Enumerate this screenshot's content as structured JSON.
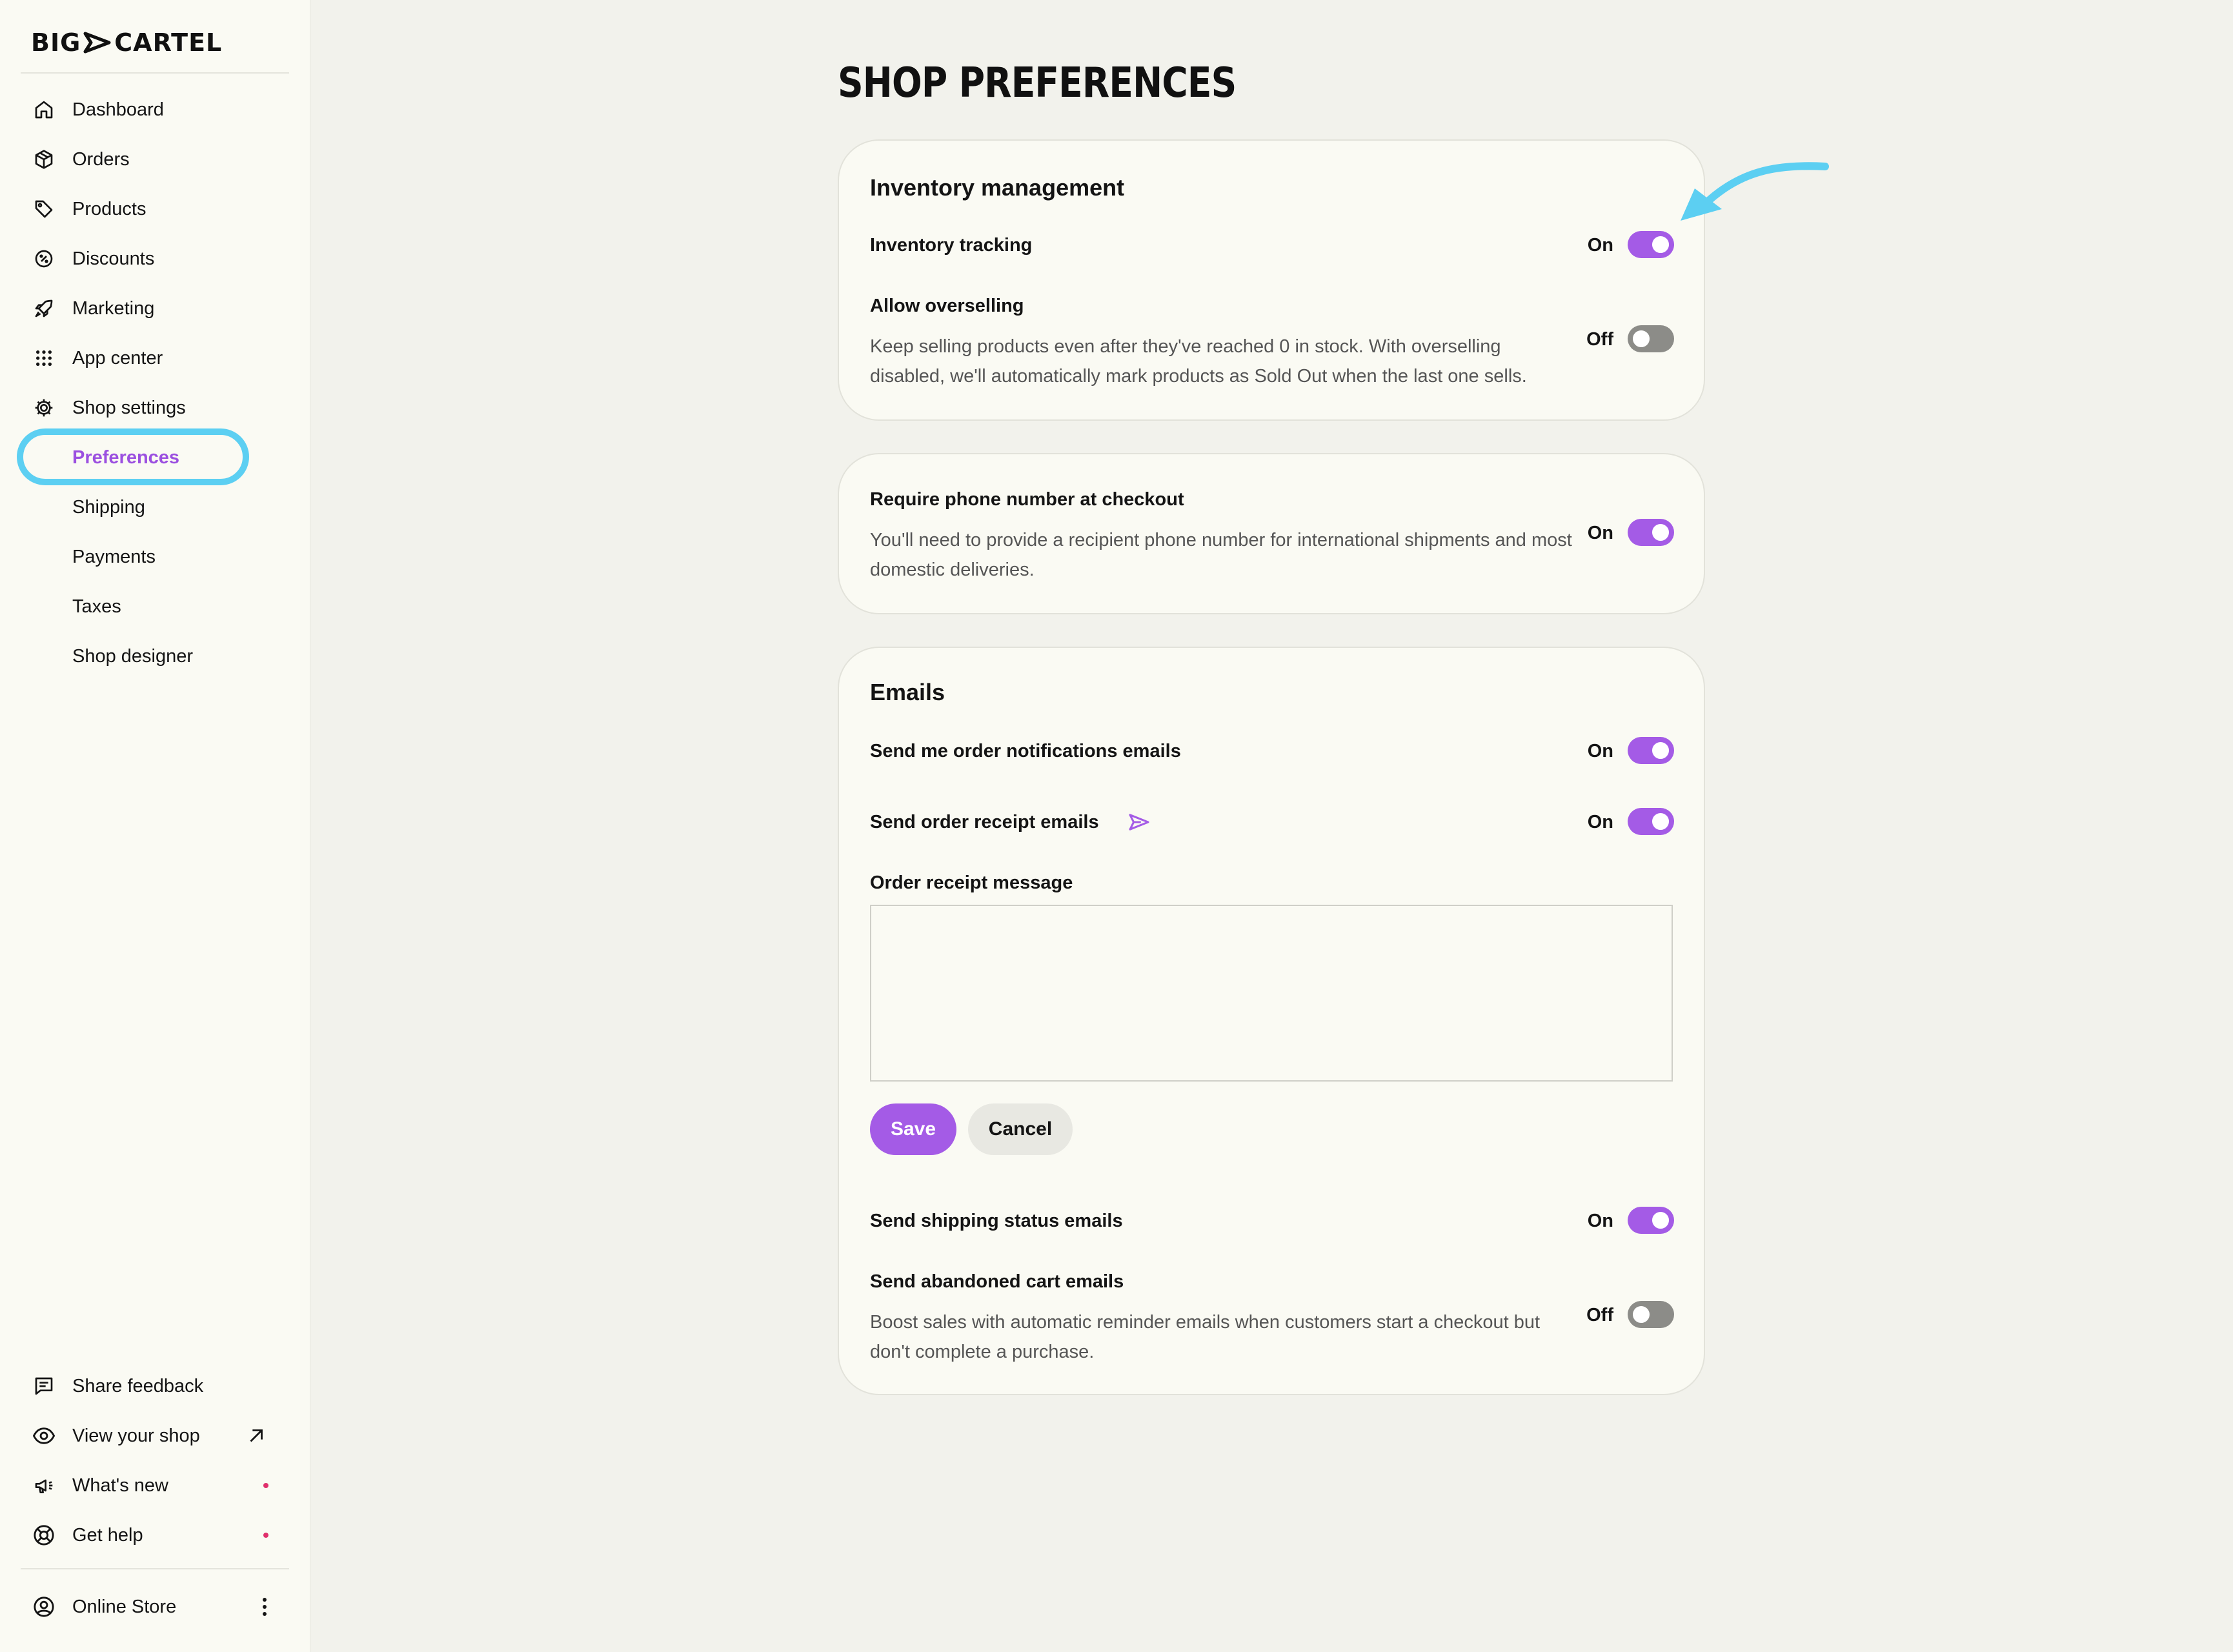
{
  "brand": {
    "name_left": "BIG",
    "name_right": "CARTEL"
  },
  "sidebar": {
    "nav": [
      {
        "label": "Dashboard",
        "icon": "home-icon"
      },
      {
        "label": "Orders",
        "icon": "box-icon"
      },
      {
        "label": "Products",
        "icon": "tag-icon"
      },
      {
        "label": "Discounts",
        "icon": "discount-icon"
      },
      {
        "label": "Marketing",
        "icon": "rocket-icon"
      },
      {
        "label": "App center",
        "icon": "grid-icon"
      },
      {
        "label": "Shop settings",
        "icon": "gear-icon"
      }
    ],
    "settings_sub": [
      {
        "label": "Preferences",
        "active": true
      },
      {
        "label": "Shipping"
      },
      {
        "label": "Payments"
      },
      {
        "label": "Taxes"
      },
      {
        "label": "Shop designer"
      }
    ],
    "bottom": [
      {
        "label": "Share feedback",
        "icon": "feedback-icon"
      },
      {
        "label": "View your shop",
        "icon": "eye-icon"
      },
      {
        "label": "What's new",
        "icon": "megaphone-icon"
      },
      {
        "label": "Get help",
        "icon": "lifebuoy-icon"
      }
    ],
    "account": {
      "label": "Online Store",
      "icon": "user-circle-icon"
    }
  },
  "page": {
    "title": "SHOP PREFERENCES"
  },
  "inventory": {
    "title": "Inventory management",
    "tracking": {
      "label": "Inventory tracking",
      "state": "On"
    },
    "overselling": {
      "label": "Allow overselling",
      "description": "Keep selling products even after they've reached 0 in stock. With overselling disabled, we'll automatically mark products as Sold Out when the last one sells.",
      "state": "Off"
    }
  },
  "phone": {
    "label": "Require phone number at checkout",
    "description": "You'll need to provide a recipient phone number for international shipments and most domestic deliveries.",
    "state": "On"
  },
  "emails": {
    "title": "Emails",
    "order_notifications": {
      "label": "Send me order notifications emails",
      "state": "On"
    },
    "order_receipt": {
      "label": "Send order receipt emails",
      "state": "On"
    },
    "receipt_message": {
      "label": "Order receipt message",
      "value": ""
    },
    "save_label": "Save",
    "cancel_label": "Cancel",
    "shipping_status": {
      "label": "Send shipping status emails",
      "state": "On"
    },
    "abandoned_cart": {
      "label": "Send abandoned cart emails",
      "description": "Boost sales with automatic reminder emails when customers start a checkout but don't complete a purchase.",
      "state": "Off"
    }
  },
  "colors": {
    "accent": "#a45be6",
    "annotation": "#5ccff2",
    "notification_dot": "#e0306c"
  }
}
